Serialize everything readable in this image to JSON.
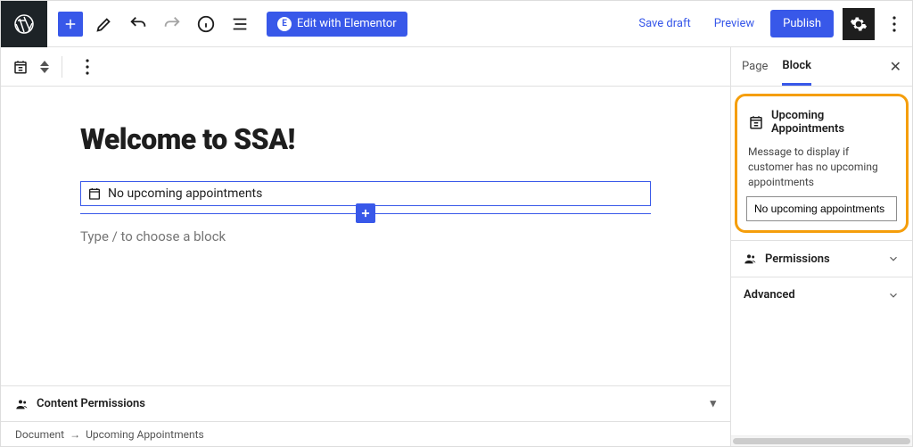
{
  "topbar": {
    "elementor_label": "Edit with Elementor",
    "save_draft": "Save draft",
    "preview": "Preview",
    "publish": "Publish"
  },
  "editor": {
    "page_title": "Welcome to SSA!",
    "selected_block_text": "No upcoming appointments",
    "placeholder": "Type / to choose a block"
  },
  "content_permissions": {
    "label": "Content Permissions"
  },
  "breadcrumb": {
    "root": "Document",
    "leaf": "Upcoming Appointments"
  },
  "sidebar": {
    "tabs": {
      "page": "Page",
      "block": "Block"
    },
    "block_panel": {
      "title": "Upcoming Appointments",
      "field_label": "Message to display if customer has no upcoming appointments",
      "field_value": "No upcoming appointments"
    },
    "accordion": {
      "permissions": "Permissions",
      "advanced": "Advanced"
    }
  }
}
